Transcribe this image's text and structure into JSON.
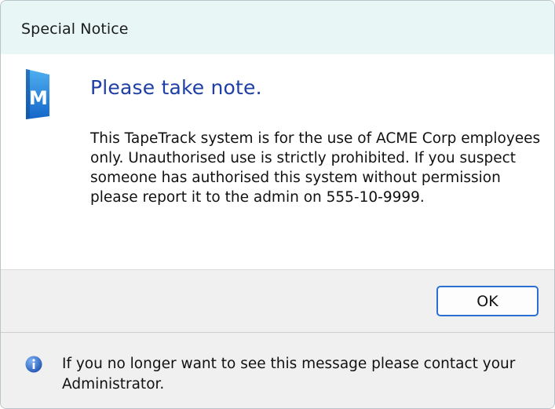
{
  "window": {
    "title": "Special Notice"
  },
  "dialog": {
    "icon": "m-app-logo-icon",
    "heading": "Please take note.",
    "message": "This TapeTrack system is for the use of ACME Corp employees only. Unauthorised use is strictly prohibited. If you suspect someone has authorised this system without permission please report it to the admin on 555-10-9999."
  },
  "buttons": {
    "ok_label": "OK"
  },
  "footer": {
    "icon": "info-icon",
    "text": "If you no longer want to see this message please contact your Administrator."
  },
  "colors": {
    "titlebar_bg": "#e8f6f6",
    "heading": "#1f3fa6",
    "footer_bg": "#f0f0f0",
    "button_border": "#2a6fd1"
  }
}
